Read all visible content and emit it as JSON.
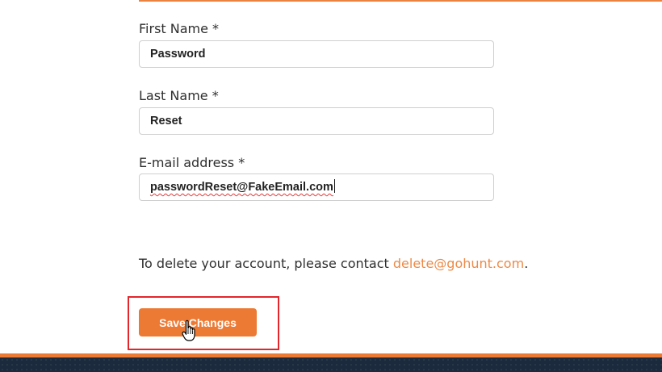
{
  "form": {
    "first_name": {
      "label": "First Name *",
      "value": "Password"
    },
    "last_name": {
      "label": "Last Name *",
      "value": "Reset"
    },
    "email": {
      "label": "E-mail address *",
      "value": "passwordReset@FakeEmail.com"
    }
  },
  "account_note": {
    "prefix": "To delete your account, please contact ",
    "link_text": "delete@gohunt.com",
    "suffix": "."
  },
  "actions": {
    "save_label": "Save Changes"
  },
  "colors": {
    "accent": "#ec7a35",
    "link": "#ec8a48",
    "highlight": "#e2262c",
    "footer": "#1b2a3d"
  },
  "icons": {
    "cursor": "hand-pointer-icon"
  }
}
